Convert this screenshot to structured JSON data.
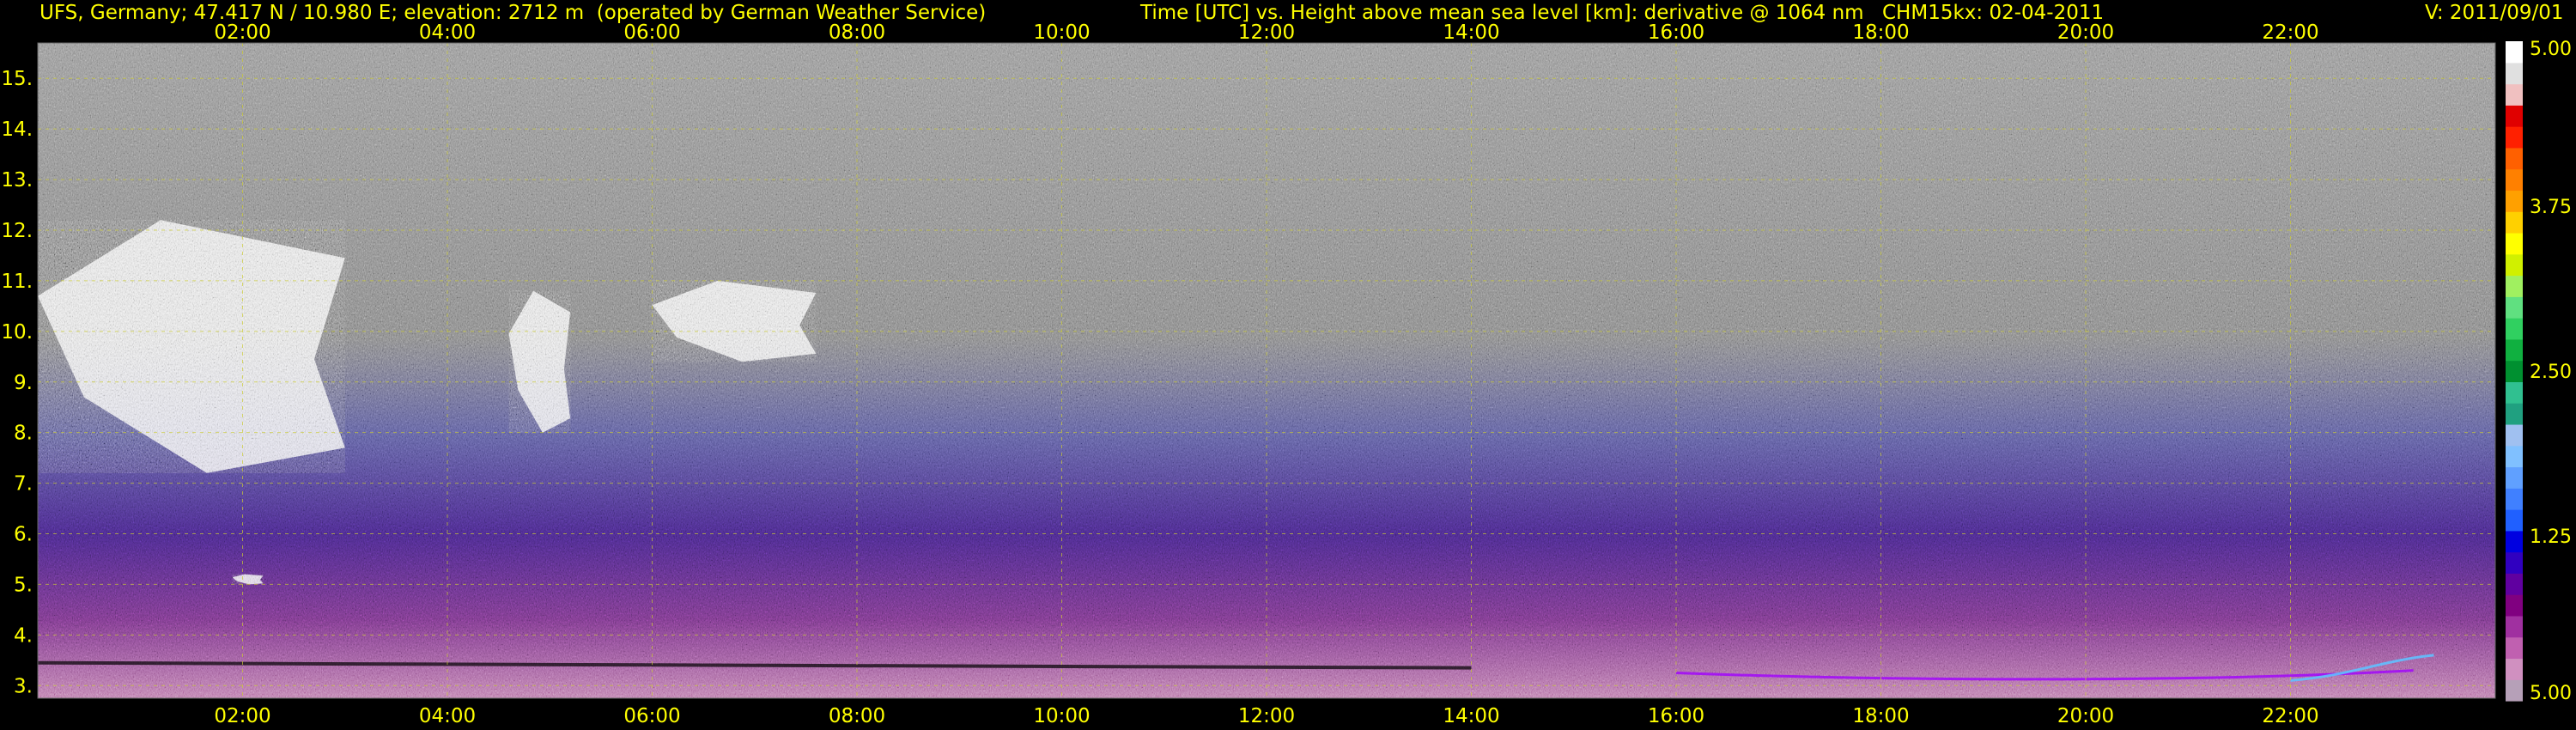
{
  "header": {
    "station": "UFS, Germany; 47.417 N / 10.980 E; elevation: 2712 m  (operated by German Weather Service)",
    "axes": "Time [UTC] vs. Height above mean sea level [km]: derivative @ 1064 nm",
    "instrument": "CHM15kx: 02-04-2011",
    "version": "V: 2011/09/01"
  },
  "chart_data": {
    "type": "heatmap",
    "xlabel": "Time [UTC]",
    "ylabel": "Height above mean sea level [km]",
    "x_ticks": [
      "02:00",
      "04:00",
      "06:00",
      "08:00",
      "10:00",
      "12:00",
      "14:00",
      "16:00",
      "18:00",
      "20:00",
      "22:00"
    ],
    "x_tick_hours": [
      2,
      4,
      6,
      8,
      10,
      12,
      14,
      16,
      18,
      20,
      22
    ],
    "xlim_hours": [
      0,
      24
    ],
    "y_ticks": [
      3,
      4,
      5,
      6,
      7,
      8,
      9,
      10,
      11,
      12,
      13,
      14,
      15
    ],
    "ylim_km": [
      2.75,
      15.7
    ],
    "grid": true,
    "colorbar": {
      "labels": [
        "5.00",
        "3.75",
        "2.50",
        "1.25",
        "5.00"
      ],
      "label_fractions": [
        1.0,
        0.75,
        0.5,
        0.25,
        0.0
      ],
      "colors": [
        "#b6a0b8",
        "#d090c0",
        "#c060b0",
        "#a030a0",
        "#800080",
        "#6000a0",
        "#3000c0",
        "#0000e0",
        "#2060ff",
        "#4080ff",
        "#60a0ff",
        "#80c0ff",
        "#a0c0f0",
        "#20a080",
        "#30c090",
        "#009030",
        "#10b040",
        "#30d060",
        "#60e080",
        "#a0f060",
        "#d0f000",
        "#ffff00",
        "#ffd000",
        "#ffa000",
        "#ff8000",
        "#ff6000",
        "#ff2000",
        "#e00000",
        "#f0c0c0",
        "#e0e0e0",
        "#ffffff"
      ]
    },
    "features": [
      {
        "kind": "cloud",
        "t_start": 0.0,
        "t_end": 3.0,
        "z_bottom_km": 7.2,
        "z_top_km": 12.2
      },
      {
        "kind": "cloud",
        "t_start": 4.6,
        "t_end": 5.2,
        "z_bottom_km": 8.0,
        "z_top_km": 10.8
      },
      {
        "kind": "cloud",
        "t_start": 6.0,
        "t_end": 7.6,
        "z_bottom_km": 9.4,
        "z_top_km": 11.0
      },
      {
        "kind": "cloud",
        "t_start": 1.9,
        "t_end": 2.2,
        "z_bottom_km": 5.0,
        "z_top_km": 5.2
      }
    ]
  }
}
